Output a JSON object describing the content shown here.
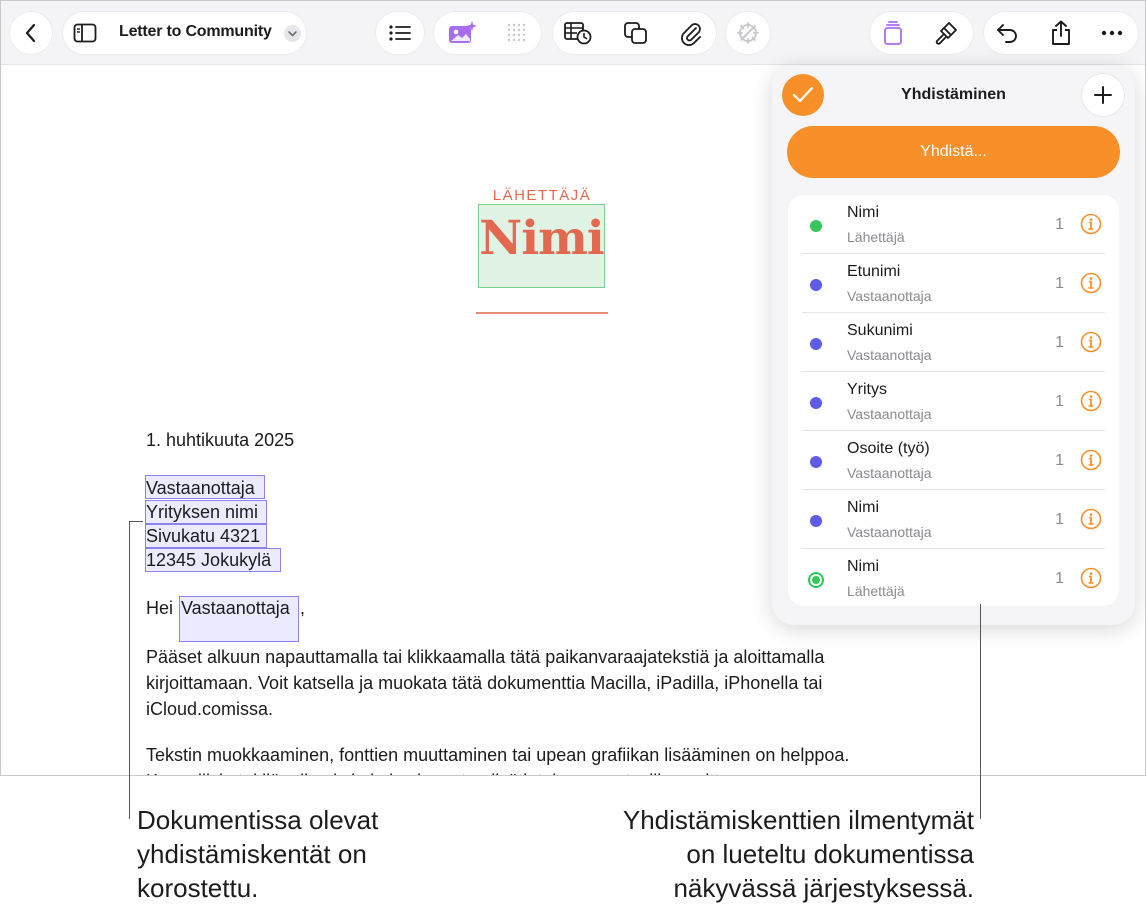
{
  "toolbar": {
    "doc_title": "Letter to Community"
  },
  "document": {
    "sender_label": "LÄHETTÄJÄ",
    "sender_name": "Nimi",
    "date": "1. huhtikuuta 2025",
    "address": [
      "Vastaanottaja",
      "Yrityksen nimi",
      "Sivukatu 4321",
      "12345 Jokukylä"
    ],
    "greeting_prefix": "Hei",
    "greeting_field": "Vastaanottaja",
    "greeting_suffix": ",",
    "paragraph1": [
      "Pääset alkuun napauttamalla tai klikkaamalla tätä paikanvaraajatekstiä ja aloittamalla",
      "kirjoittamaan. Voit katsella ja muokata tätä dokumenttia Macilla, iPadilla, iPhonella tai",
      "iCloud.comissa."
    ],
    "paragraph2": "Tekstin muokkaaminen, fonttien muuttaminen tai upean grafiikan lisääminen on helppoa."
  },
  "panel": {
    "title": "Yhdistäminen",
    "merge_button": "Yhdistä...",
    "fields": [
      {
        "name": "Nimi",
        "type": "Lähettäjä",
        "count": "1",
        "color": "#34c759",
        "selected": false
      },
      {
        "name": "Etunimi",
        "type": "Vastaanottaja",
        "count": "1",
        "color": "#5e5ce6",
        "selected": false
      },
      {
        "name": "Sukunimi",
        "type": "Vastaanottaja",
        "count": "1",
        "color": "#5e5ce6",
        "selected": false
      },
      {
        "name": "Yritys",
        "type": "Vastaanottaja",
        "count": "1",
        "color": "#5e5ce6",
        "selected": false
      },
      {
        "name": "Osoite (työ)",
        "type": "Vastaanottaja",
        "count": "1",
        "color": "#5e5ce6",
        "selected": false
      },
      {
        "name": "Nimi",
        "type": "Vastaanottaja",
        "count": "1",
        "color": "#5e5ce6",
        "selected": false
      },
      {
        "name": "Nimi",
        "type": "Lähettäjä",
        "count": "1",
        "color": "#34c759",
        "selected": true
      }
    ]
  },
  "callouts": {
    "left": [
      "Dokumentissa olevat",
      "yhdistämiskentät on",
      "korostettu."
    ],
    "right": [
      "Yhdistämiskenttien ilmentymät",
      "on lueteltu dokumentissa",
      "näkyvässä järjestyksessä."
    ]
  },
  "colors": {
    "accent_orange": "#f8902a",
    "sender_field_fill": "#e0f3e5",
    "recipient_field_fill": "#ebeaff",
    "sender_text": "#e2694f"
  }
}
